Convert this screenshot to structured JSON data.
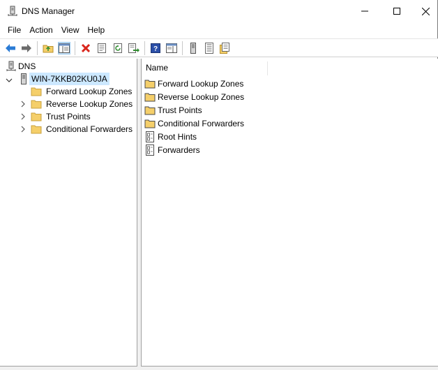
{
  "window": {
    "title": "DNS Manager",
    "minimize_glyph": "—",
    "maximize_glyph": "☐",
    "close_glyph": "✕"
  },
  "menu": {
    "items": [
      "File",
      "Action",
      "View",
      "Help"
    ]
  },
  "toolbar": {
    "buttons": [
      {
        "name": "back-icon"
      },
      {
        "name": "forward-icon"
      },
      {
        "name": "up-folder-icon"
      },
      {
        "name": "show-hide-console-tree-icon",
        "pressed": true
      },
      {
        "name": "delete-icon"
      },
      {
        "name": "properties-icon"
      },
      {
        "name": "refresh-icon"
      },
      {
        "name": "export-list-icon"
      },
      {
        "name": "help-icon"
      },
      {
        "name": "show-hide-action-pane-icon"
      },
      {
        "name": "server-icon"
      },
      {
        "name": "list-view-icon"
      },
      {
        "name": "zone-folders-icon"
      }
    ]
  },
  "tree": {
    "root": "DNS",
    "server": "WIN-7KKB02KU0JA",
    "children": [
      {
        "label": "Forward Lookup Zones",
        "expandable": false
      },
      {
        "label": "Reverse Lookup Zones",
        "expandable": true
      },
      {
        "label": "Trust Points",
        "expandable": true
      },
      {
        "label": "Conditional Forwarders",
        "expandable": true
      }
    ]
  },
  "list": {
    "column_name": "Name",
    "items": [
      {
        "label": "Forward Lookup Zones",
        "icon": "folder-icon"
      },
      {
        "label": "Reverse Lookup Zones",
        "icon": "folder-icon"
      },
      {
        "label": "Trust Points",
        "icon": "folder-icon"
      },
      {
        "label": "Conditional Forwarders",
        "icon": "folder-icon"
      },
      {
        "label": "Root Hints",
        "icon": "document-icon"
      },
      {
        "label": "Forwarders",
        "icon": "document-icon"
      }
    ]
  },
  "colors": {
    "selection": "#cce8ff",
    "folder": "#f5cf6a",
    "back_arrow": "#2a7bd5",
    "delete": "#d9261c"
  }
}
